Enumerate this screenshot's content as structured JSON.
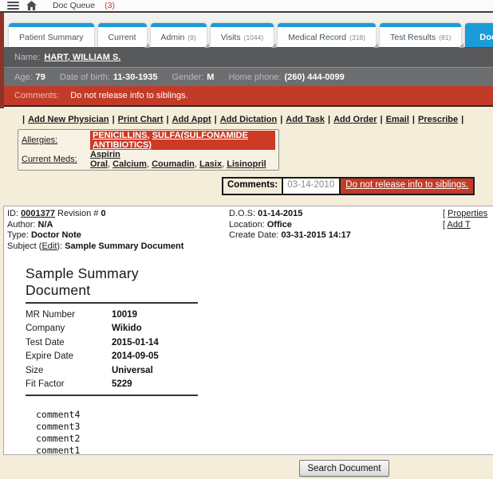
{
  "topbar": {
    "title": "Doc Queue",
    "count": "(3)"
  },
  "tabs": [
    {
      "label": "Patient Summary",
      "count": ""
    },
    {
      "label": "Current",
      "count": ""
    },
    {
      "label": "Admin",
      "count": "(9)"
    },
    {
      "label": "Visits",
      "count": "(1044)"
    },
    {
      "label": "Medical Record",
      "count": "(318)"
    },
    {
      "label": "Test Results",
      "count": "(81)"
    },
    {
      "label": "Document S",
      "count": ""
    }
  ],
  "patient": {
    "name_label": "Name:",
    "name": "HART, WILLIAM S.",
    "demographics": [
      {
        "label": "Age:",
        "value": "79"
      },
      {
        "label": "Date of birth:",
        "value": "11-30-1935"
      },
      {
        "label": "Gender:",
        "value": "M"
      },
      {
        "label": "Home phone:",
        "value": "(260) 444-0099"
      }
    ],
    "comments_label": "Comments:",
    "comments": "Do not release info to siblings."
  },
  "actions": [
    "Add New Physician",
    "Print Chart",
    "Add Appt",
    "Add Dictation",
    "Add Task",
    "Add Order",
    "Email",
    "Prescribe"
  ],
  "allergy_box": {
    "allergies_label": "Allergies:",
    "allergies": [
      "PENICILLINS",
      "SULFA(SULFONAMIDE ANTIBIOTICS)"
    ],
    "meds_label": "Current Meds:",
    "meds": [
      "Aspirin Oral",
      "Calcium",
      "Coumadin",
      "Lasix",
      "Lisinopril"
    ]
  },
  "doc_comments": {
    "label": "Comments:",
    "date": "03-14-2010",
    "text": "Do not release info to siblings."
  },
  "document": {
    "meta": {
      "id_label": "ID:",
      "id": "0001377",
      "revision_label": "Revision #",
      "revision": "0",
      "author_label": "Author:",
      "author": "N/A",
      "type_label": "Type:",
      "type": "Doctor Note",
      "subject_label": "Subject",
      "edit_label": "Edit",
      "subject": "Sample Summary Document",
      "dos_label": "D.O.S:",
      "dos": "01-14-2015",
      "location_label": "Location:",
      "location": "Office",
      "create_label": "Create Date:",
      "create": "03-31-2015 14:17"
    },
    "links": {
      "prefix": "[",
      "properties": "Properties",
      "add_t": "Add T"
    },
    "body": {
      "title": "Sample Summary Document",
      "fields": [
        {
          "label": "MR Number",
          "value": "10019"
        },
        {
          "label": "Company",
          "value": "Wikido"
        },
        {
          "label": "Test Date",
          "value": "2015-01-14"
        },
        {
          "label": "Expire Date",
          "value": "2014-09-05"
        },
        {
          "label": "Size",
          "value": "Universal"
        },
        {
          "label": "Fit Factor",
          "value": "5229"
        }
      ],
      "comments": [
        "comment4",
        "comment3",
        "comment2",
        "comment1"
      ]
    }
  },
  "search_button": "Search Document",
  "colors": {
    "accent_blue": "#1d9bd8",
    "alert_red": "#c23b28",
    "allergy_red": "#cd3a25",
    "left_strip_red": "#8e3426",
    "name_bar_gray": "#58595b",
    "age_bar_gray": "#6d6e70",
    "page_beige": "#f4edda"
  }
}
